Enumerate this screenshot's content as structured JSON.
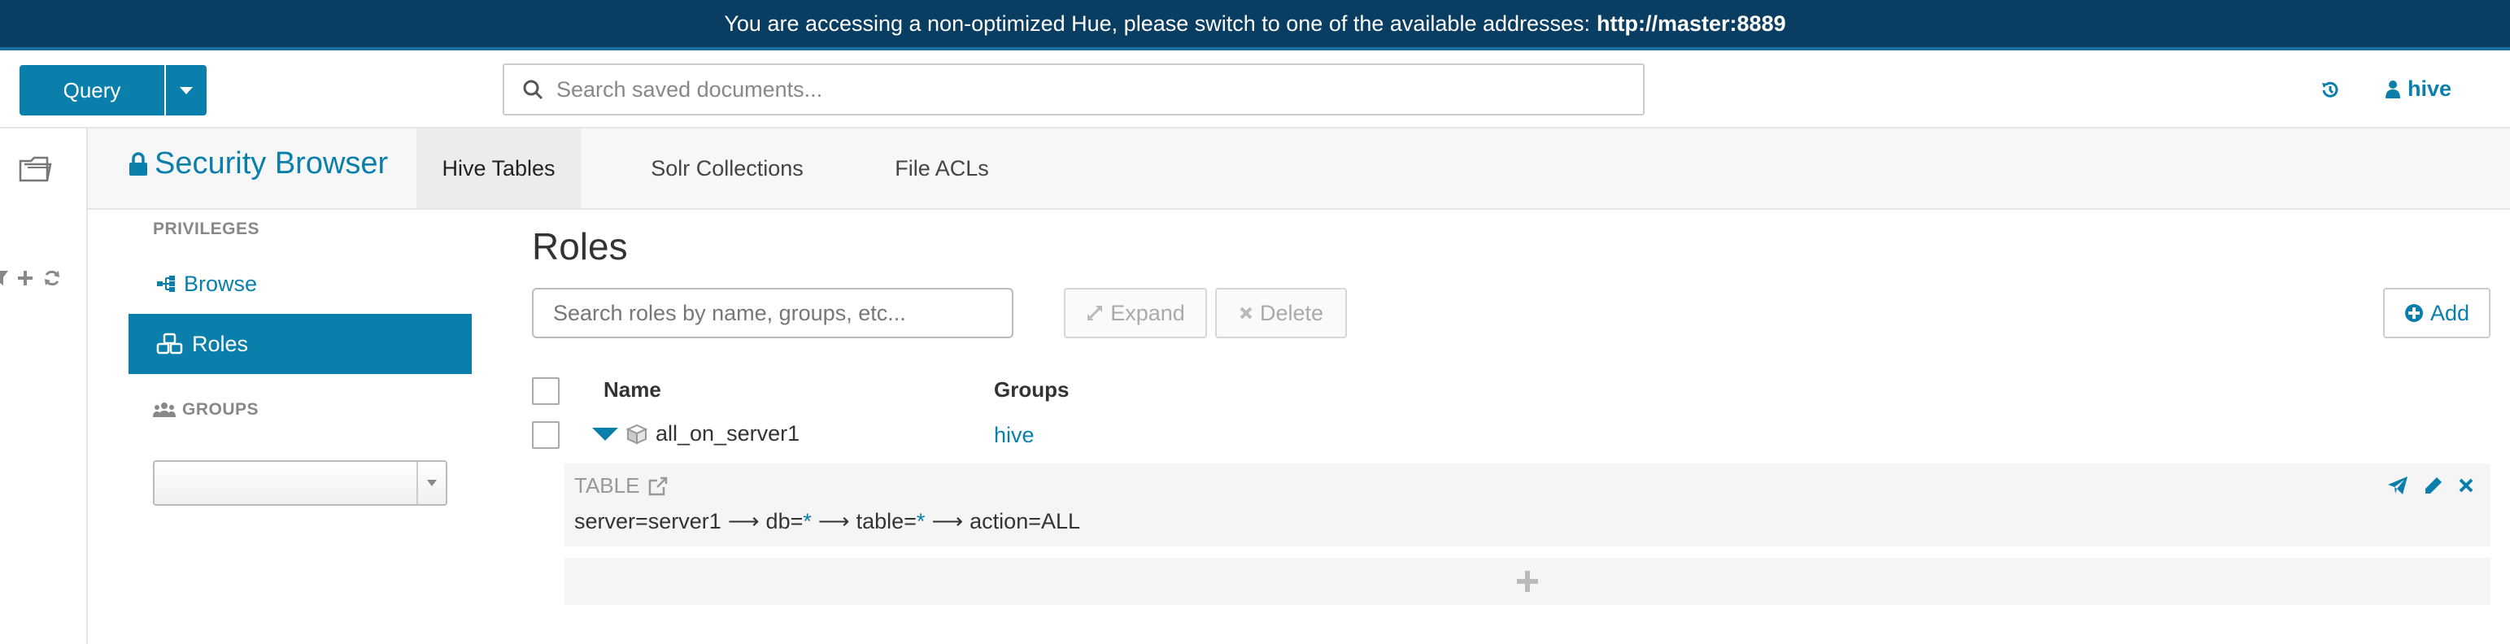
{
  "banner": {
    "message": "You are accessing a non-optimized Hue, please switch to one of the available addresses:",
    "address": "http://master:8889"
  },
  "topbar": {
    "query_label": "Query",
    "search_placeholder": "Search saved documents...",
    "user_name": "hive"
  },
  "app": {
    "title": "Security Browser",
    "tabs": [
      {
        "label": "Hive Tables",
        "active": true
      },
      {
        "label": "Solr Collections",
        "active": false
      },
      {
        "label": "File ACLs",
        "active": false
      }
    ]
  },
  "sidebar": {
    "privileges_heading": "PRIVILEGES",
    "items": [
      {
        "label": "Browse",
        "icon": "sitemap-icon"
      },
      {
        "label": "Roles",
        "icon": "cubes-icon",
        "active": true
      }
    ],
    "groups_heading": "GROUPS",
    "groups_select_value": ""
  },
  "main": {
    "title": "Roles",
    "search_placeholder": "Search roles by name, groups, etc...",
    "expand_label": "Expand",
    "delete_label": "Delete",
    "add_label": "Add",
    "columns": {
      "name": "Name",
      "groups": "Groups"
    },
    "rows": [
      {
        "name": "all_on_server1",
        "group": "hive",
        "privilege": {
          "type": "TABLE",
          "server": "server=server1",
          "db_prefix": "db=",
          "db_value": "*",
          "table_prefix": "table=",
          "table_value": "*",
          "action": "action=ALL"
        }
      }
    ]
  },
  "colors": {
    "banner_bg": "#0a3d62",
    "accent": "#0b7fab"
  }
}
